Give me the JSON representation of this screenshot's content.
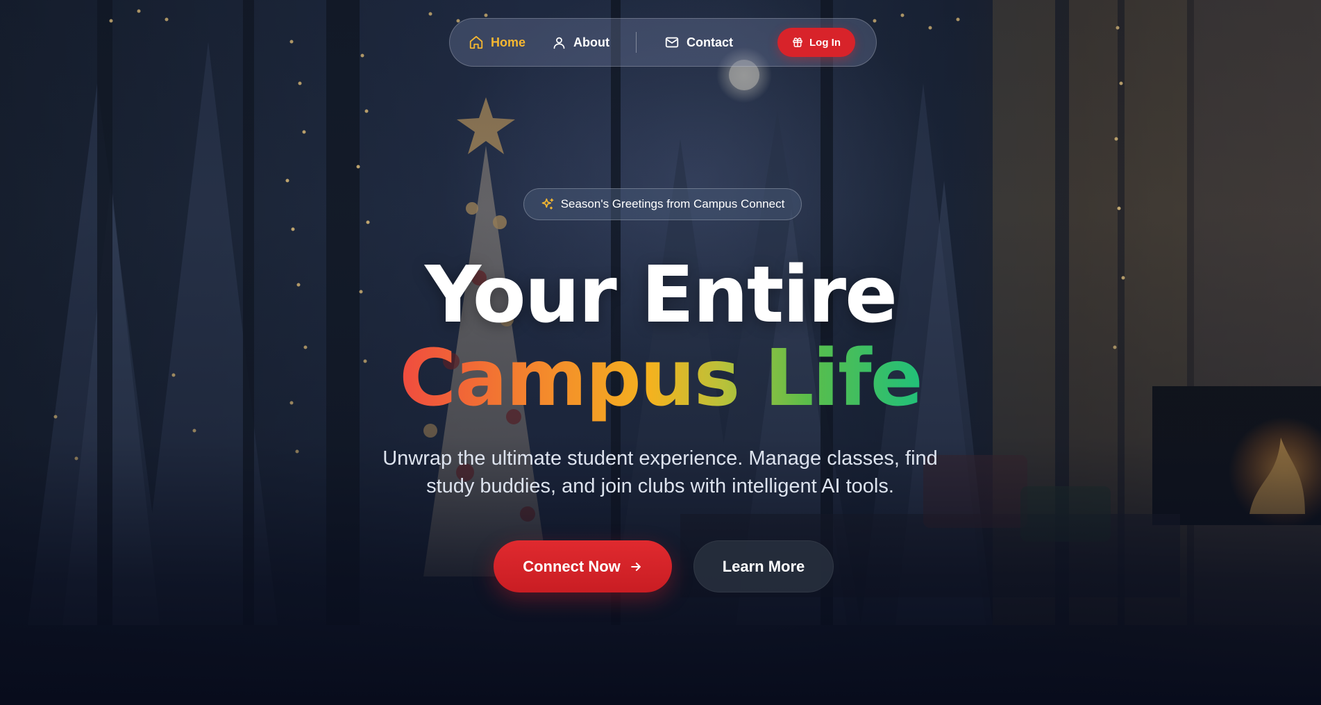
{
  "nav": {
    "items": [
      {
        "label": "Home",
        "icon": "home-icon",
        "active": true
      },
      {
        "label": "About",
        "icon": "user-icon",
        "active": false
      },
      {
        "label": "Contact",
        "icon": "mail-icon",
        "active": false
      }
    ],
    "login": {
      "label": "Log In",
      "icon": "gift-icon"
    }
  },
  "badge": {
    "icon": "sparkles-icon",
    "text": "Season's Greetings from Campus Connect"
  },
  "hero": {
    "line1": "Your Entire",
    "line2": "Campus Life",
    "subtitle": "Unwrap the ultimate student experience. Manage classes, find study buddies, and join clubs with intelligent AI tools."
  },
  "cta": {
    "primary": {
      "label": "Connect Now",
      "icon": "arrow-right-icon"
    },
    "secondary": {
      "label": "Learn More"
    }
  },
  "colors": {
    "accent_red": "#d8232a",
    "active_nav": "#f5b731",
    "gradient": [
      "#ef4b3f",
      "#f48a2c",
      "#f4b21f",
      "#5bbd4a",
      "#21c07a"
    ]
  }
}
